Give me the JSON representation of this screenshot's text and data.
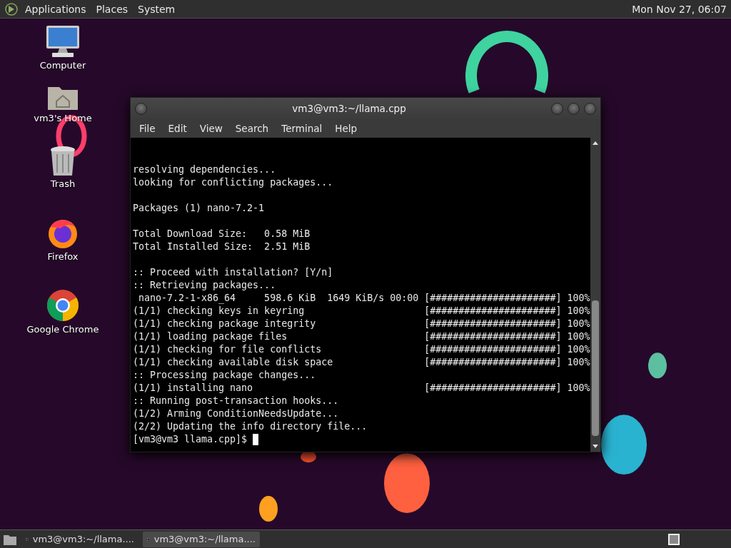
{
  "top_panel": {
    "menus": [
      "Applications",
      "Places",
      "System"
    ],
    "clock": "Mon Nov 27, 06:07"
  },
  "desktop_icons": [
    {
      "kind": "computer",
      "label": "Computer"
    },
    {
      "kind": "home",
      "label": "vm3's Home"
    },
    {
      "kind": "trash",
      "label": "Trash"
    },
    {
      "kind": "firefox",
      "label": "Firefox"
    },
    {
      "kind": "chrome",
      "label": "Google Chrome"
    }
  ],
  "terminal": {
    "title": "vm3@vm3:~/llama.cpp",
    "menus": [
      "File",
      "Edit",
      "View",
      "Search",
      "Terminal",
      "Help"
    ],
    "blocks": [
      [
        "resolving dependencies...",
        "looking for conflicting packages..."
      ],
      [
        "Packages (1) nano-7.2-1"
      ],
      [
        "Total Download Size:   0.58 MiB",
        "Total Installed Size:  2.51 MiB"
      ],
      [
        ":: Proceed with installation? [Y/n]",
        ":: Retrieving packages...",
        " nano-7.2-1-x86_64     598.6 KiB  1649 KiB/s 00:00 [######################] 100%",
        "(1/1) checking keys in keyring                     [######################] 100%",
        "(1/1) checking package integrity                   [######################] 100%",
        "(1/1) loading package files                        [######################] 100%",
        "(1/1) checking for file conflicts                  [######################] 100%",
        "(1/1) checking available disk space                [######################] 100%",
        ":: Processing package changes...",
        "(1/1) installing nano                              [######################] 100%",
        ":: Running post-transaction hooks...",
        "(1/2) Arming ConditionNeedsUpdate...",
        "(2/2) Updating the info directory file..."
      ]
    ],
    "prompt": "[vm3@vm3 llama.cpp]$ "
  },
  "taskbar": {
    "tasks": [
      {
        "label": "vm3@vm3:~/llama....",
        "selected": false
      },
      {
        "label": "vm3@vm3:~/llama....",
        "selected": true
      }
    ]
  }
}
